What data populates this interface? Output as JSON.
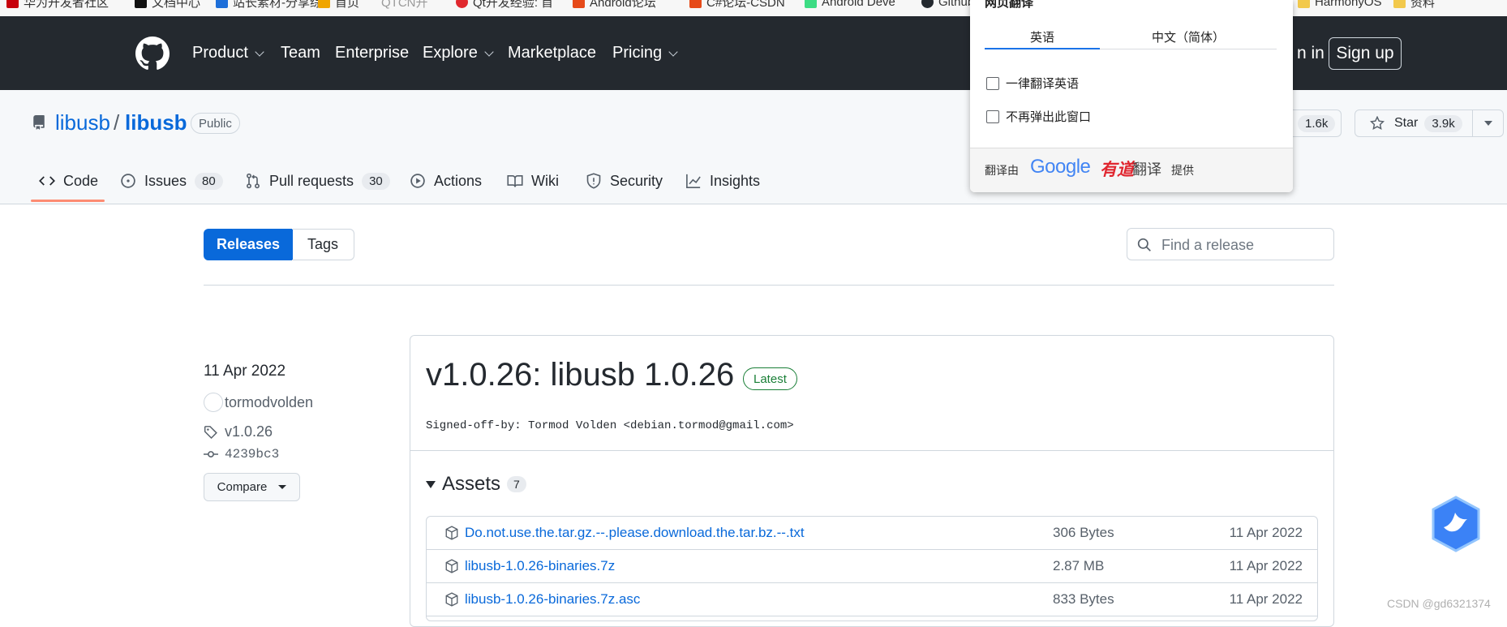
{
  "bookmarks": [
    {
      "label": "华为开发者社区",
      "color": "#c7000b"
    },
    {
      "label": "文档中心",
      "color": "#111111"
    },
    {
      "label": "站长素材-分享综",
      "color": "#1e6fd9"
    },
    {
      "label": "首页",
      "color": "#f0a500"
    },
    {
      "label": "QTCN开",
      "color": "#cccccc"
    },
    {
      "label": "Qt开发经验: 首",
      "color": "#e0282e"
    },
    {
      "label": "Android论坛",
      "color": "#e64a19"
    },
    {
      "label": "C#论坛-CSDN",
      "color": "#e64a19"
    },
    {
      "label": "Android Deve",
      "color": "#3ddc84"
    },
    {
      "label": "Github",
      "color": "#24292f"
    },
    {
      "label": "HarmonyOS",
      "color": "#f2c94c"
    },
    {
      "label": "资料",
      "color": "#f2c94c"
    }
  ],
  "header": {
    "nav": [
      {
        "label": "Product",
        "dropdown": true
      },
      {
        "label": "Team",
        "dropdown": false
      },
      {
        "label": "Enterprise",
        "dropdown": false
      },
      {
        "label": "Explore",
        "dropdown": true
      },
      {
        "label": "Marketplace",
        "dropdown": false
      },
      {
        "label": "Pricing",
        "dropdown": true
      }
    ],
    "signin_partial": "n in",
    "signup": "Sign up"
  },
  "repo": {
    "owner": "libusb",
    "separator": "/",
    "name": "libusb",
    "visibility": "Public",
    "fork_count": "1.6k",
    "star_label": "Star",
    "star_count": "3.9k"
  },
  "tabs": [
    {
      "label": "Code",
      "icon": "code-icon",
      "active": true
    },
    {
      "label": "Issues",
      "icon": "issue-icon",
      "count": "80"
    },
    {
      "label": "Pull requests",
      "icon": "pull-request-icon",
      "count": "30"
    },
    {
      "label": "Actions",
      "icon": "play-icon"
    },
    {
      "label": "Wiki",
      "icon": "book-icon"
    },
    {
      "label": "Security",
      "icon": "shield-icon"
    },
    {
      "label": "Insights",
      "icon": "graph-icon"
    }
  ],
  "releases_nav": {
    "releases": "Releases",
    "tags": "Tags",
    "search_placeholder": "Find a release"
  },
  "release": {
    "date": "11 Apr 2022",
    "author": "tormodvolden",
    "tag": "v1.0.26",
    "commit": "4239bc3",
    "compare": "Compare",
    "title": "v1.0.26: libusb 1.0.26",
    "badge": "Latest",
    "signoff": "Signed-off-by: Tormod Volden <debian.tormod@gmail.com>",
    "assets_label": "Assets",
    "assets_count": "7",
    "assets": [
      {
        "name": "Do.not.use.the.tar.gz.--.please.download.the.tar.bz.--.txt",
        "size": "306 Bytes",
        "date": "11 Apr 2022"
      },
      {
        "name": "libusb-1.0.26-binaries.7z",
        "size": "2.87 MB",
        "date": "11 Apr 2022"
      },
      {
        "name": "libusb-1.0.26-binaries.7z.asc",
        "size": "833 Bytes",
        "date": "11 Apr 2022"
      }
    ]
  },
  "translate": {
    "title": "网页翻译",
    "tab_en": "英语",
    "tab_zh": "中文（简体）",
    "opt_always": "一律翻译英语",
    "opt_never": "不再弹出此窗口",
    "by_prefix": "翻译由",
    "brand_google": "Google",
    "brand_youdao": "有道",
    "brand_fanyi": "翻译",
    "by_suffix": "提供"
  },
  "watermark": "CSDN @gd6321374"
}
